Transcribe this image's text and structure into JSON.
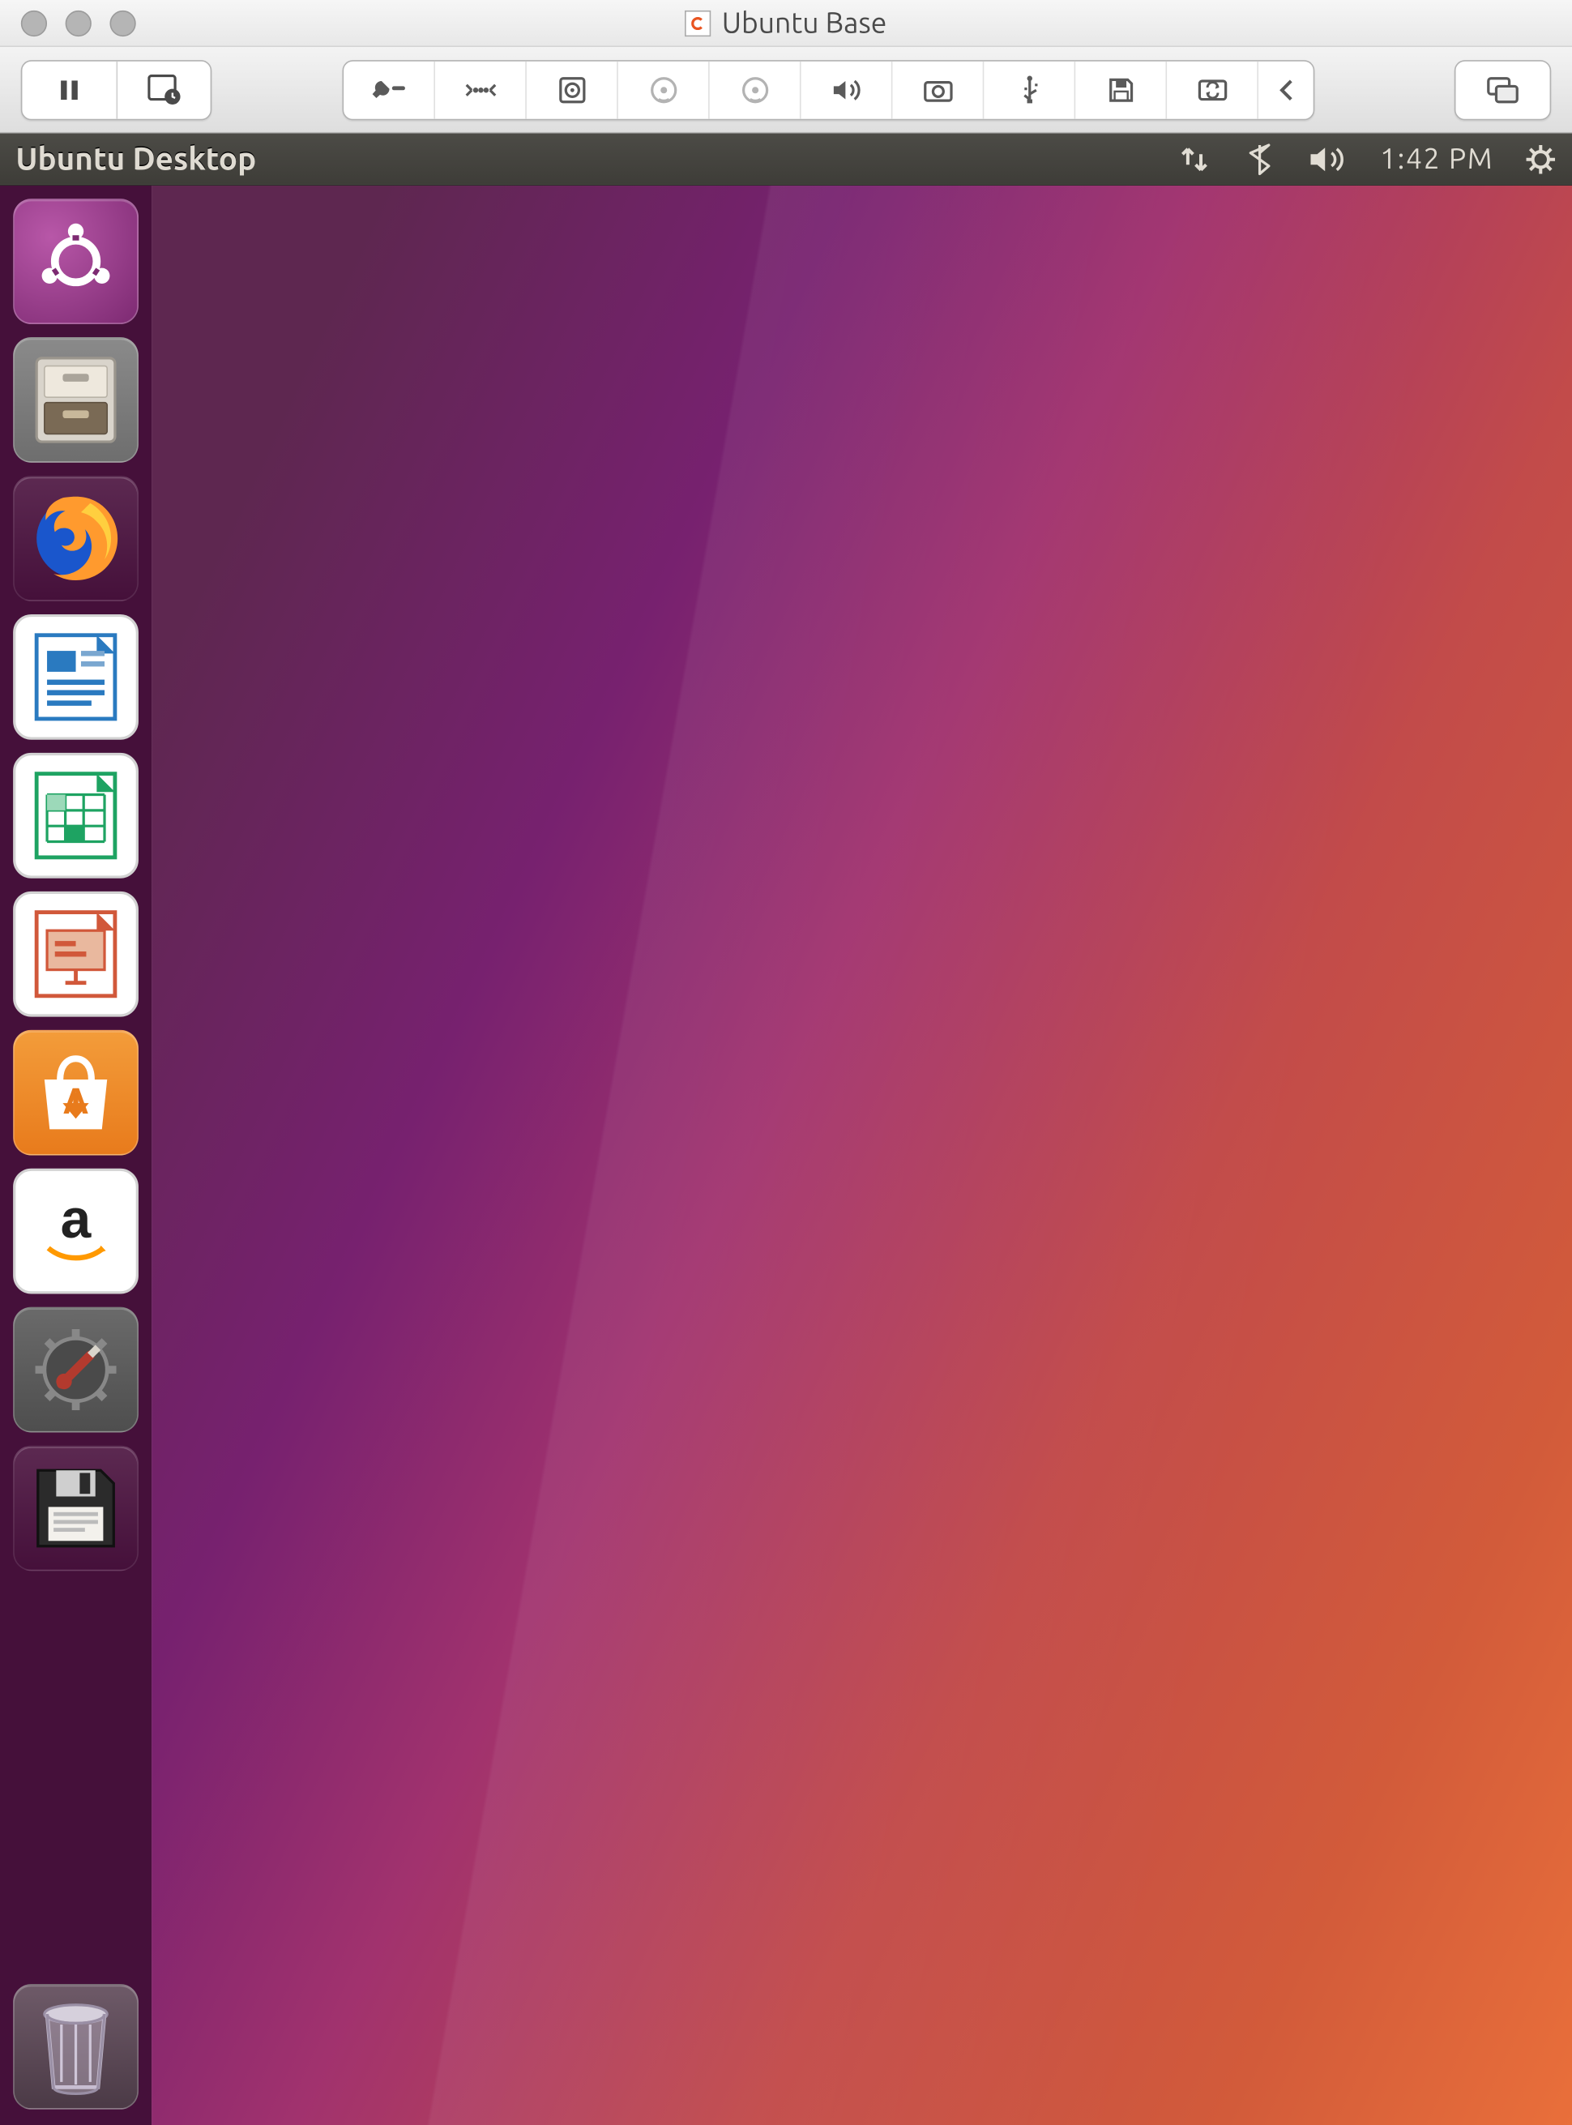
{
  "vm_window": {
    "title": "Ubuntu Base",
    "traffic_lights": [
      "close",
      "minimize",
      "zoom"
    ],
    "left_buttons": [
      "pause",
      "snapshot"
    ],
    "toolstrip": [
      "settings-wrench",
      "network-adapter",
      "hard-disk",
      "cd-drive-1",
      "cd-drive-2",
      "sound",
      "camera",
      "usb",
      "floppy",
      "shared-folders",
      "collapse-arrow"
    ],
    "right_buttons": [
      "fullscreen"
    ]
  },
  "ubuntu_panel": {
    "title": "Ubuntu Desktop",
    "indicators": {
      "network": "network-updown",
      "bluetooth": "bluetooth",
      "sound": "volume-high",
      "time": "1:42 PM",
      "session": "gear-power"
    }
  },
  "launcher": {
    "items": [
      {
        "name": "dash",
        "label": "Search / Dash"
      },
      {
        "name": "files",
        "label": "Files"
      },
      {
        "name": "firefox",
        "label": "Firefox Web Browser"
      },
      {
        "name": "writer",
        "label": "LibreOffice Writer"
      },
      {
        "name": "calc",
        "label": "LibreOffice Calc"
      },
      {
        "name": "impress",
        "label": "LibreOffice Impress"
      },
      {
        "name": "software",
        "label": "Ubuntu Software"
      },
      {
        "name": "amazon",
        "label": "Amazon"
      },
      {
        "name": "system-settings",
        "label": "System Settings"
      },
      {
        "name": "floppy-disk",
        "label": "Floppy Disk"
      }
    ],
    "trash": {
      "name": "trash",
      "label": "Trash"
    }
  }
}
